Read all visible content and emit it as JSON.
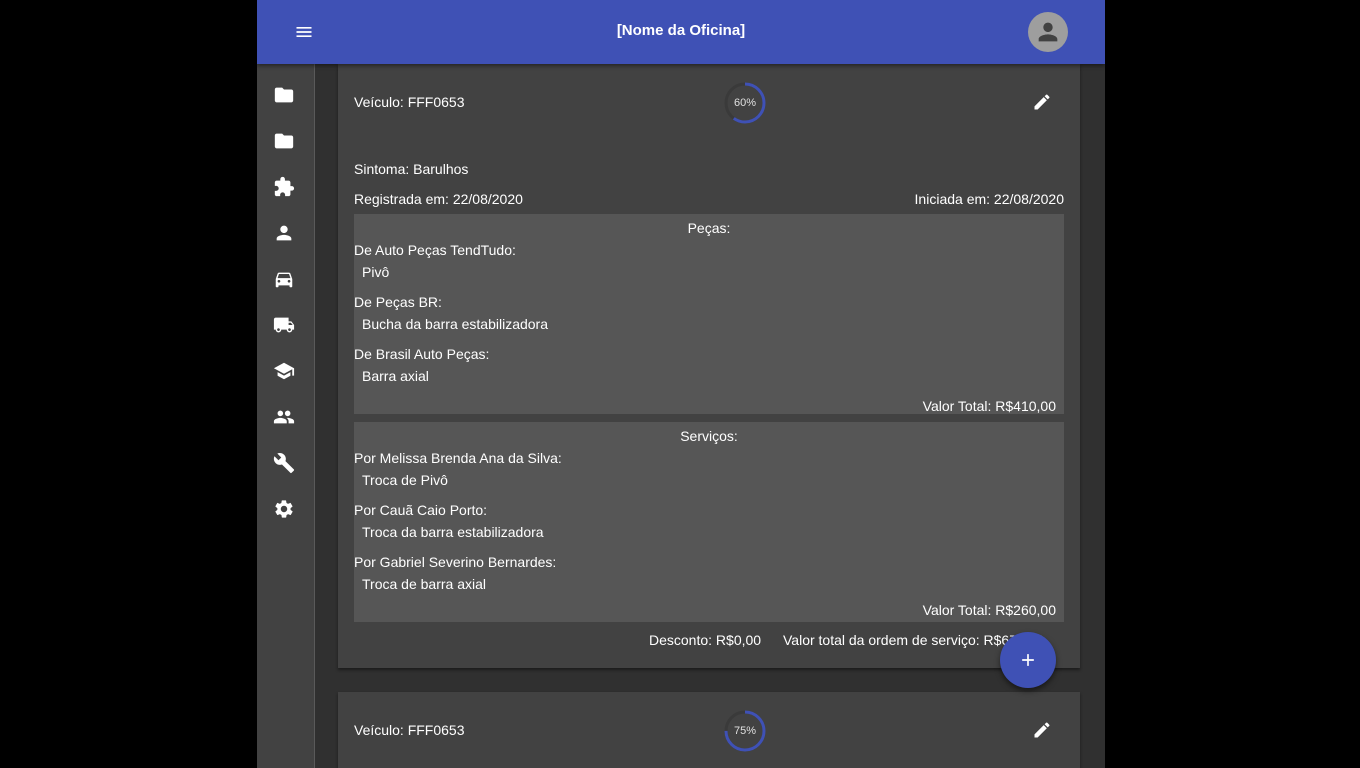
{
  "header": {
    "title": "[Nome da Oficina]",
    "menu_icon": "menu-icon",
    "avatar_icon": "account-icon"
  },
  "sidebar": {
    "items": [
      {
        "icon": "folder-icon"
      },
      {
        "icon": "folder-icon"
      },
      {
        "icon": "puzzle-icon"
      },
      {
        "icon": "person-icon"
      },
      {
        "icon": "car-icon"
      },
      {
        "icon": "truck-icon"
      },
      {
        "icon": "school-icon"
      },
      {
        "icon": "people-icon"
      },
      {
        "icon": "wrench-icon"
      },
      {
        "icon": "settings-icon"
      }
    ]
  },
  "orders": [
    {
      "vehicle": "Veículo: FFF0653",
      "progress": 60,
      "progress_label": "60%",
      "symptom": "Sintoma: Barulhos",
      "registered": "Registrada em: 22/08/2020",
      "started": "Iniciada em: 22/08/2020",
      "parts": {
        "title": "Peças:",
        "groups": [
          {
            "source": "De Auto Peças TendTudo:",
            "item": "Pivô"
          },
          {
            "source": "De Peças BR:",
            "item": "Bucha da barra estabilizadora"
          },
          {
            "source": "De Brasil Auto Peças:",
            "item": "Barra axial"
          }
        ],
        "total": "Valor Total: R$410,00"
      },
      "services": {
        "title": "Serviços:",
        "groups": [
          {
            "source": "Por Melissa Brenda Ana da Silva:",
            "item": "Troca de Pivô"
          },
          {
            "source": "Por Cauã Caio Porto:",
            "item": "Troca da barra estabilizadora"
          },
          {
            "source": "Por Gabriel Severino Bernardes:",
            "item": "Troca de barra axial"
          }
        ],
        "total": "Valor Total: R$260,00"
      },
      "discount": "Desconto: R$0,00",
      "grand_total": "Valor total da ordem de serviço: R$670,00"
    },
    {
      "vehicle": "Veículo: FFF0653",
      "progress": 75,
      "progress_label": "75%"
    }
  ],
  "fab": {
    "icon": "add-icon"
  },
  "colors": {
    "primary": "#3f51b5",
    "surface": "#424242",
    "panel": "#565656",
    "background": "#303030"
  }
}
